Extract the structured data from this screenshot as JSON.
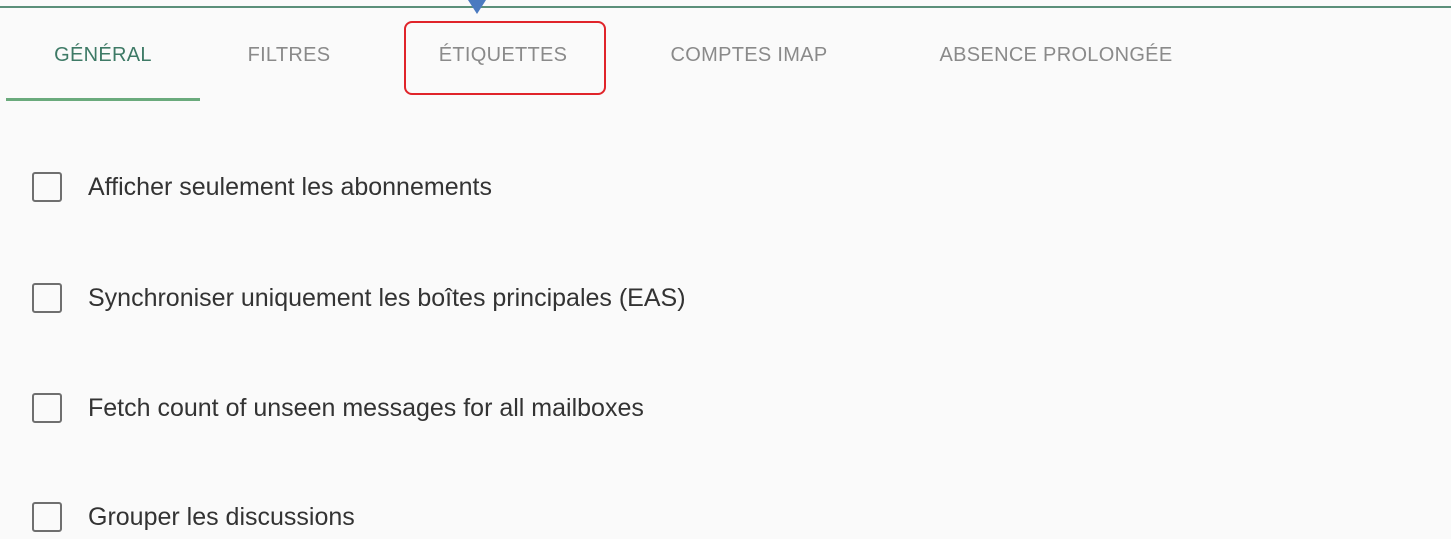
{
  "tabs": [
    {
      "label": "GÉNÉRAL",
      "active": true
    },
    {
      "label": "FILTRES",
      "active": false
    },
    {
      "label": "ÉTIQUETTES",
      "active": false
    },
    {
      "label": "COMPTES IMAP",
      "active": false
    },
    {
      "label": "ABSENCE PROLONGÉE",
      "active": false
    }
  ],
  "options": [
    {
      "label": "Afficher seulement les abonnements",
      "checked": false
    },
    {
      "label": "Synchroniser uniquement les boîtes principales (EAS)",
      "checked": false
    },
    {
      "label": "Fetch count of unseen messages for all mailboxes",
      "checked": false
    },
    {
      "label": "Grouper les discussions",
      "checked": false
    }
  ],
  "colors": {
    "active_tab": "#3e7a66",
    "underline": "#6aaa7c",
    "highlight": "#e0242a",
    "arrow": "#4a7ac0"
  }
}
